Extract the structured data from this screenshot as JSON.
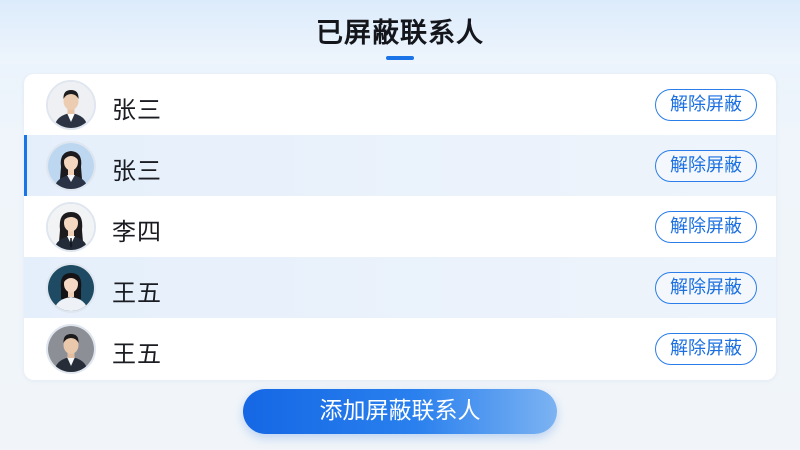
{
  "header": {
    "title": "已屏蔽联系人"
  },
  "contacts": [
    {
      "name": "张三",
      "avatar": "male-avatar",
      "action": "解除屏蔽"
    },
    {
      "name": "张三",
      "avatar": "female-avatar",
      "action": "解除屏蔽"
    },
    {
      "name": "李四",
      "avatar": "female-avatar",
      "action": "解除屏蔽"
    },
    {
      "name": "王五",
      "avatar": "female-avatar",
      "action": "解除屏蔽"
    },
    {
      "name": "王五",
      "avatar": "male-avatar",
      "action": "解除屏蔽"
    }
  ],
  "footer": {
    "add_label": "添加屏蔽联系人"
  },
  "colors": {
    "accent": "#1b73e8",
    "row_highlight": "#e5effb"
  }
}
